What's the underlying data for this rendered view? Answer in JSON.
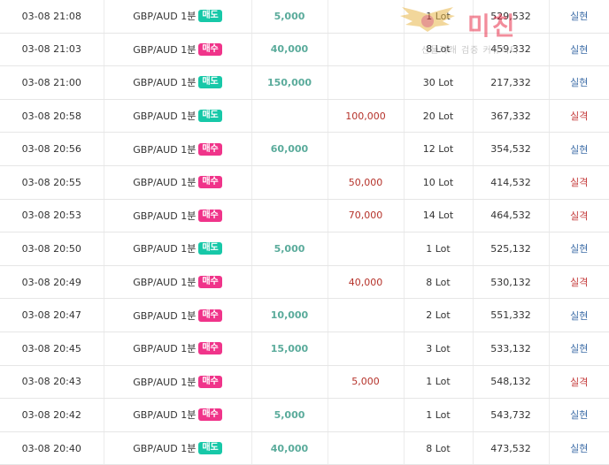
{
  "rows": [
    {
      "time": "03-08 21:08",
      "symbol": "GBP/AUD 1분",
      "side": "매도",
      "type": "sell",
      "profit": "5,000",
      "loss": "",
      "lot": "1 Lot",
      "balance": "529,532",
      "result": "실현",
      "res": "win"
    },
    {
      "time": "03-08 21:03",
      "symbol": "GBP/AUD 1분",
      "side": "매수",
      "type": "buy",
      "profit": "40,000",
      "loss": "",
      "lot": "8 Lot",
      "balance": "459,332",
      "result": "실현",
      "res": "win"
    },
    {
      "time": "03-08 21:00",
      "symbol": "GBP/AUD 1분",
      "side": "매도",
      "type": "sell",
      "profit": "150,000",
      "loss": "",
      "lot": "30 Lot",
      "balance": "217,332",
      "result": "실현",
      "res": "win"
    },
    {
      "time": "03-08 20:58",
      "symbol": "GBP/AUD 1분",
      "side": "매도",
      "type": "sell",
      "profit": "",
      "loss": "100,000",
      "lot": "20 Lot",
      "balance": "367,332",
      "result": "실격",
      "res": "loss"
    },
    {
      "time": "03-08 20:56",
      "symbol": "GBP/AUD 1분",
      "side": "매수",
      "type": "buy",
      "profit": "60,000",
      "loss": "",
      "lot": "12 Lot",
      "balance": "354,532",
      "result": "실현",
      "res": "win"
    },
    {
      "time": "03-08 20:55",
      "symbol": "GBP/AUD 1분",
      "side": "매수",
      "type": "buy",
      "profit": "",
      "loss": "50,000",
      "lot": "10 Lot",
      "balance": "414,532",
      "result": "실격",
      "res": "loss"
    },
    {
      "time": "03-08 20:53",
      "symbol": "GBP/AUD 1분",
      "side": "매수",
      "type": "buy",
      "profit": "",
      "loss": "70,000",
      "lot": "14 Lot",
      "balance": "464,532",
      "result": "실격",
      "res": "loss"
    },
    {
      "time": "03-08 20:50",
      "symbol": "GBP/AUD 1분",
      "side": "매도",
      "type": "sell",
      "profit": "5,000",
      "loss": "",
      "lot": "1 Lot",
      "balance": "525,132",
      "result": "실현",
      "res": "win"
    },
    {
      "time": "03-08 20:49",
      "symbol": "GBP/AUD 1분",
      "side": "매수",
      "type": "buy",
      "profit": "",
      "loss": "40,000",
      "lot": "8 Lot",
      "balance": "530,132",
      "result": "실격",
      "res": "loss"
    },
    {
      "time": "03-08 20:47",
      "symbol": "GBP/AUD 1분",
      "side": "매수",
      "type": "buy",
      "profit": "10,000",
      "loss": "",
      "lot": "2 Lot",
      "balance": "551,332",
      "result": "실현",
      "res": "win"
    },
    {
      "time": "03-08 20:45",
      "symbol": "GBP/AUD 1분",
      "side": "매수",
      "type": "buy",
      "profit": "15,000",
      "loss": "",
      "lot": "3 Lot",
      "balance": "533,132",
      "result": "실현",
      "res": "win"
    },
    {
      "time": "03-08 20:43",
      "symbol": "GBP/AUD 1분",
      "side": "매수",
      "type": "buy",
      "profit": "",
      "loss": "5,000",
      "lot": "1 Lot",
      "balance": "548,132",
      "result": "실격",
      "res": "loss"
    },
    {
      "time": "03-08 20:42",
      "symbol": "GBP/AUD 1분",
      "side": "매수",
      "type": "buy",
      "profit": "5,000",
      "loss": "",
      "lot": "1 Lot",
      "balance": "543,732",
      "result": "실현",
      "res": "win"
    },
    {
      "time": "03-08 20:40",
      "symbol": "GBP/AUD 1분",
      "side": "매도",
      "type": "sell",
      "profit": "40,000",
      "loss": "",
      "lot": "8 Lot",
      "balance": "473,532",
      "result": "실현",
      "res": "win"
    }
  ],
  "watermark": {
    "title": "미친",
    "subtitle": "선물거래 검증 커뮤니티"
  },
  "colors": {
    "sell_badge": "#17c8a8",
    "buy_badge": "#f0348a",
    "profit_text": "#5aab9b",
    "loss_text": "#b5322a",
    "result_win": "#3f6ea8",
    "result_loss": "#c43a3a"
  }
}
